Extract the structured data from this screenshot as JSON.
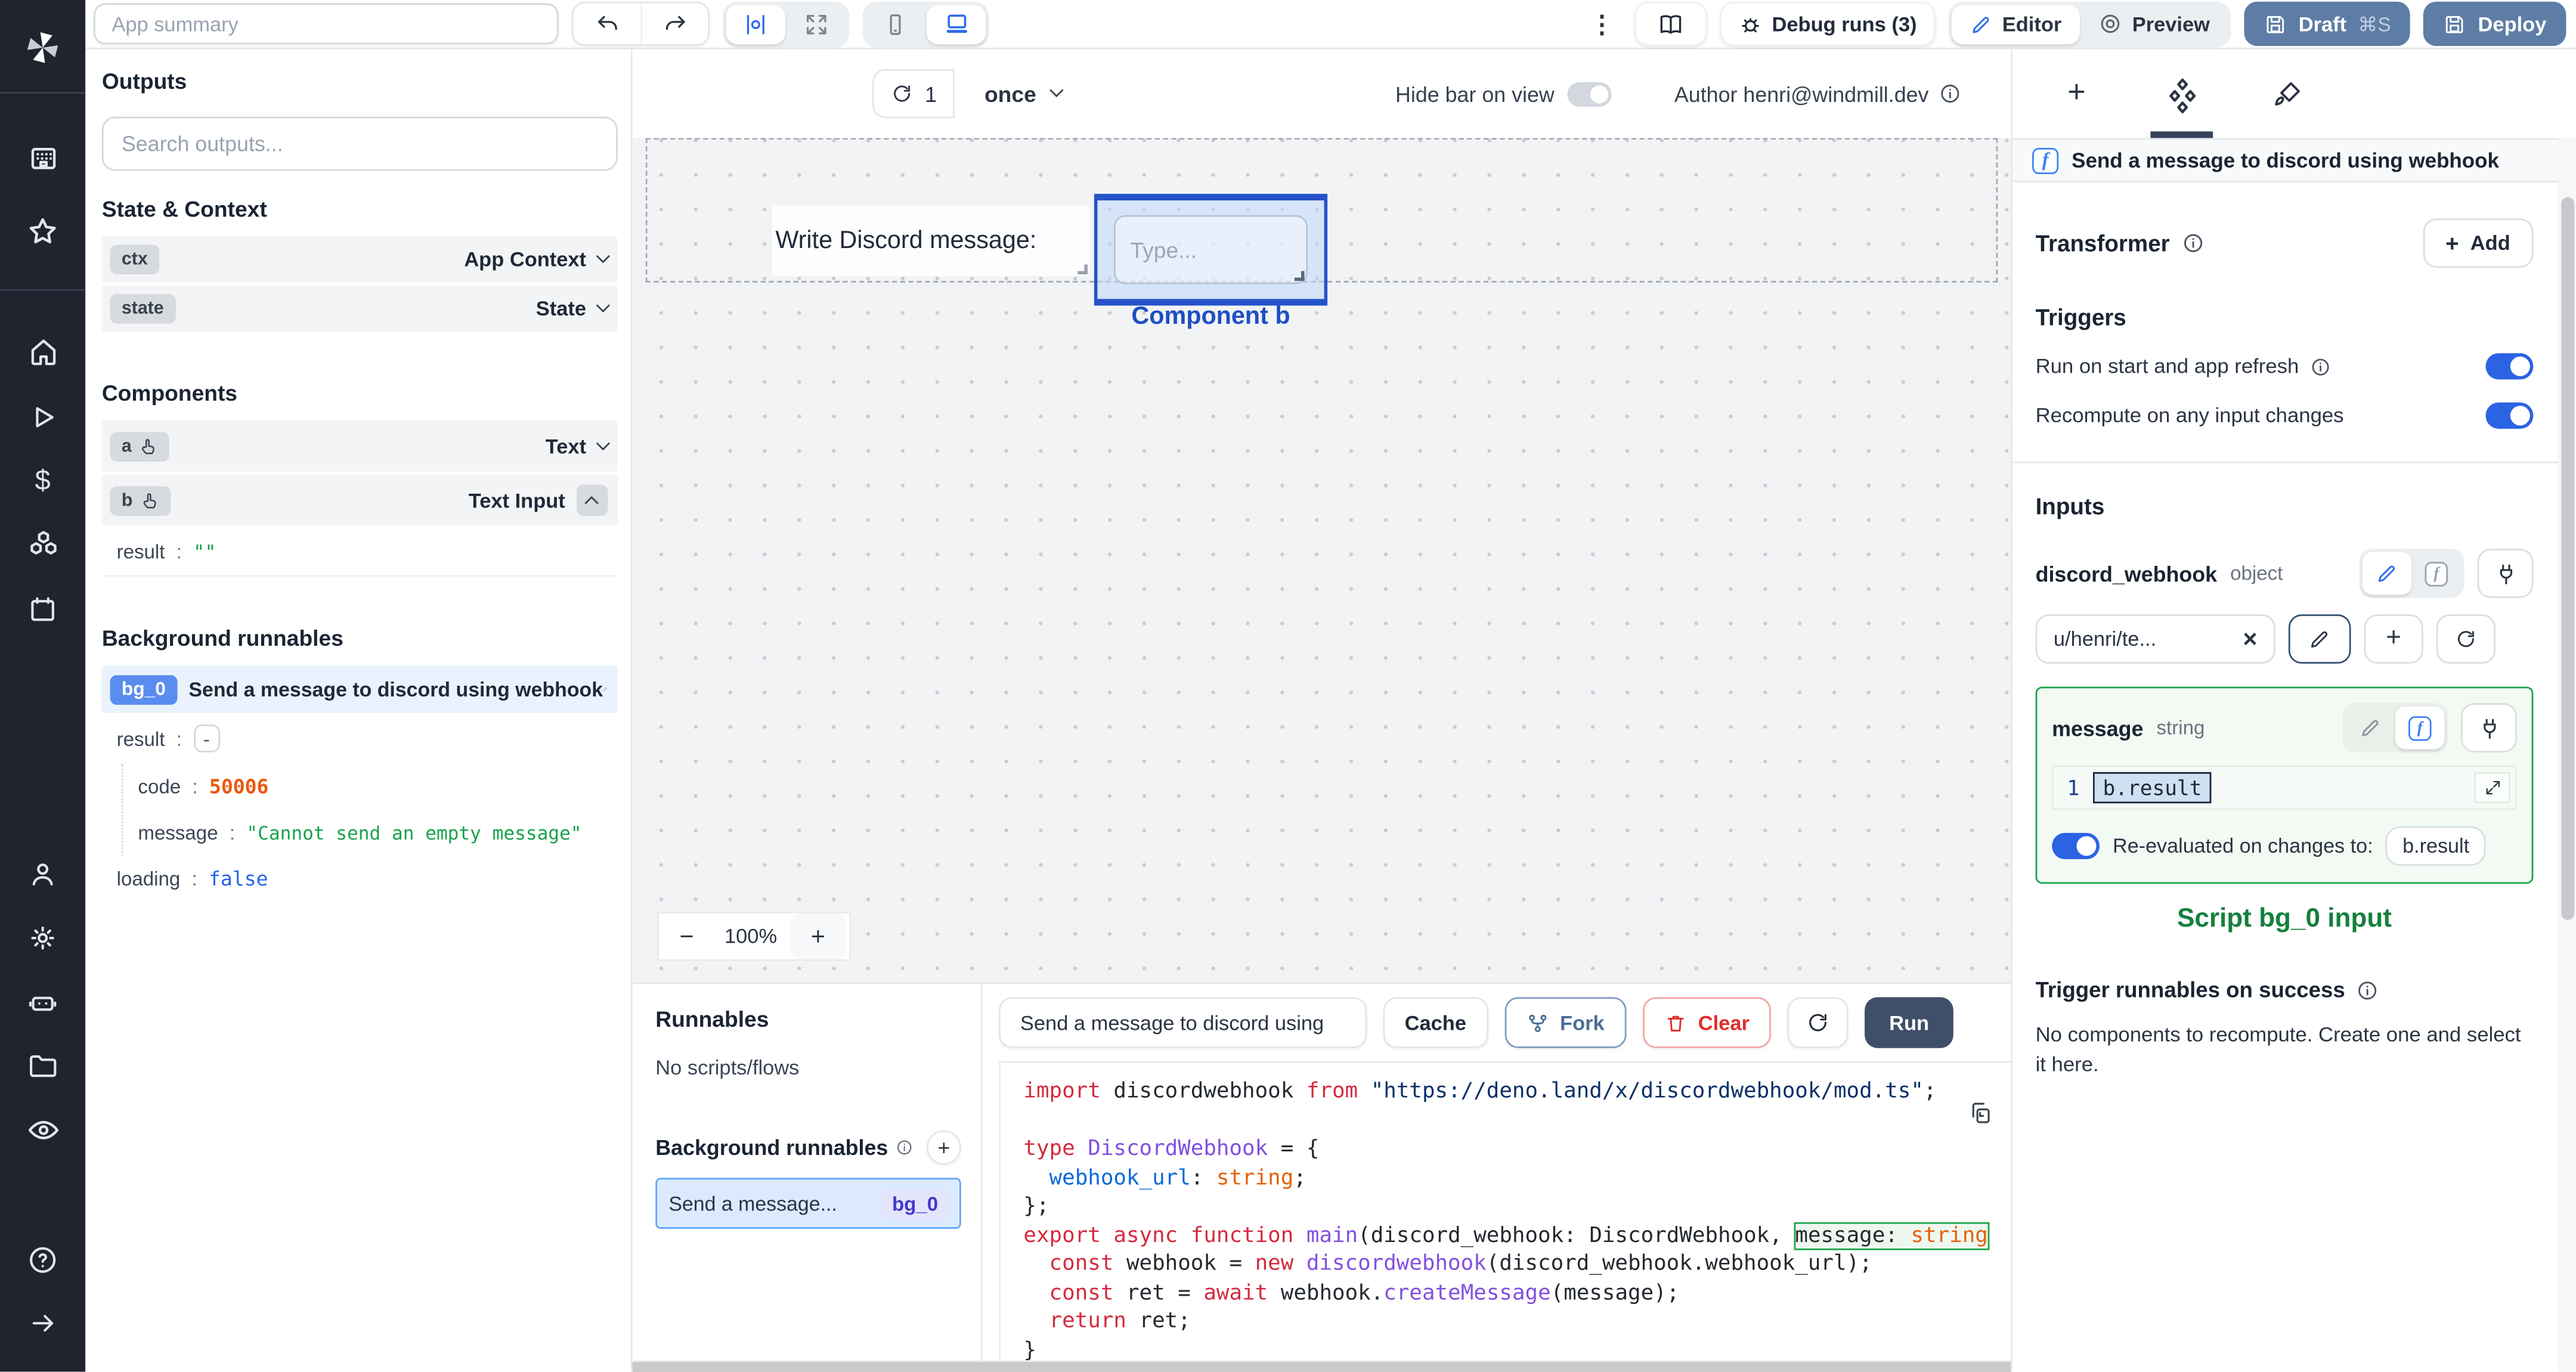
{
  "colors": {
    "accent": "#2563eb",
    "slate_button": "#5e7da6",
    "run_button": "#404f69",
    "success_green": "#16a34a",
    "error_orange": "#ea580c",
    "selection_blue": "#2553c9"
  },
  "topbar": {
    "app_summary_placeholder": "App summary",
    "debug_runs_label": "Debug runs (3)",
    "editor_label": "Editor",
    "preview_label": "Preview",
    "draft_label": "Draft",
    "draft_shortcut": "⌘S",
    "deploy_label": "Deploy"
  },
  "left_panel": {
    "outputs_title": "Outputs",
    "search_placeholder": "Search outputs...",
    "state_context_title": "State & Context",
    "context_rows": [
      {
        "key": "ctx",
        "type": "App Context"
      },
      {
        "key": "state",
        "type": "State"
      }
    ],
    "components_title": "Components",
    "component_rows": [
      {
        "key": "a",
        "type": "Text"
      },
      {
        "key": "b",
        "type": "Text Input"
      }
    ],
    "b_result": {
      "label": "result",
      "sep": ":",
      "value": "\"\""
    },
    "background_title": "Background runnables",
    "bg_runnable": {
      "badge": "bg_0",
      "name": "Send a message to discord using webhook"
    },
    "bg_result": {
      "label": "result",
      "sep": ":",
      "collapse": "-"
    },
    "bg_fields": [
      {
        "label": "code",
        "sep": ":",
        "value": "50006"
      },
      {
        "label": "message",
        "sep": ":",
        "value": "\"Cannot send an empty message\""
      },
      {
        "label": "loading",
        "sep": ":",
        "value": "false"
      }
    ]
  },
  "canvas": {
    "refresh_count": "1",
    "schedule": "once",
    "hide_bar_label": "Hide bar on view",
    "author_label": "Author henri@windmill.dev",
    "text_component": "Write Discord message:",
    "input_placeholder": "Type...",
    "selected_component_label": "Component b",
    "zoom_out": "−",
    "zoom_level": "100%",
    "zoom_in": "+"
  },
  "runnables": {
    "title": "Runnables",
    "empty": "No scripts/flows",
    "background_title": "Background runnables",
    "item": {
      "name": "Send a message...",
      "badge": "bg_0"
    }
  },
  "code_panel": {
    "tab": "Send a message to discord using",
    "cache_label": "Cache",
    "fork_label": "Fork",
    "clear_label": "Clear",
    "run_label": "Run",
    "lines": [
      [
        {
          "t": "import",
          "c": "k"
        },
        {
          "t": " discordwebhook ",
          "c": "d"
        },
        {
          "t": "from",
          "c": "k"
        },
        {
          "t": " ",
          "c": "d"
        },
        {
          "t": "\"https://deno.land/x/discordwebhook/mod.ts\"",
          "c": "s"
        },
        {
          "t": ";",
          "c": "d"
        }
      ],
      [],
      [
        {
          "t": "type",
          "c": "k"
        },
        {
          "t": " ",
          "c": "d"
        },
        {
          "t": "DiscordWebhook",
          "c": "p"
        },
        {
          "t": " = {",
          "c": "d"
        }
      ],
      [
        {
          "t": "  ",
          "c": "d"
        },
        {
          "t": "webhook_url",
          "c": "b"
        },
        {
          "t": ": ",
          "c": "d"
        },
        {
          "t": "string",
          "c": "o"
        },
        {
          "t": ";",
          "c": "d"
        }
      ],
      [
        {
          "t": "};",
          "c": "d"
        }
      ],
      [
        {
          "t": "export",
          "c": "k"
        },
        {
          "t": " ",
          "c": "d"
        },
        {
          "t": "async",
          "c": "k"
        },
        {
          "t": " ",
          "c": "d"
        },
        {
          "t": "function",
          "c": "k"
        },
        {
          "t": " ",
          "c": "d"
        },
        {
          "t": "main",
          "c": "p"
        },
        {
          "t": "(discord_webhook: DiscordWebhook, ",
          "c": "d"
        },
        {
          "t": "message: ",
          "c": "d",
          "hl": true
        },
        {
          "t": "string",
          "c": "o",
          "hl": true
        }
      ],
      [
        {
          "t": "  ",
          "c": "d"
        },
        {
          "t": "const",
          "c": "k"
        },
        {
          "t": " webhook = ",
          "c": "d"
        },
        {
          "t": "new",
          "c": "k"
        },
        {
          "t": " ",
          "c": "d"
        },
        {
          "t": "discordwebhook",
          "c": "p"
        },
        {
          "t": "(discord_webhook.webhook_url);",
          "c": "d"
        }
      ],
      [
        {
          "t": "  ",
          "c": "d"
        },
        {
          "t": "const",
          "c": "k"
        },
        {
          "t": " ret = ",
          "c": "d"
        },
        {
          "t": "await",
          "c": "k"
        },
        {
          "t": " webhook.",
          "c": "d"
        },
        {
          "t": "createMessage",
          "c": "p"
        },
        {
          "t": "(message);",
          "c": "d"
        }
      ],
      [
        {
          "t": "  ",
          "c": "d"
        },
        {
          "t": "return",
          "c": "k"
        },
        {
          "t": " ret;",
          "c": "d"
        }
      ],
      [
        {
          "t": "}",
          "c": "d"
        }
      ]
    ]
  },
  "right_panel": {
    "header": "Send a message to discord using webhook",
    "transformer_label": "Transformer",
    "add_label": "Add",
    "triggers_title": "Triggers",
    "trigger_rows": [
      "Run on start and app refresh",
      "Recompute on any input changes"
    ],
    "inputs_title": "Inputs",
    "discord_field": {
      "name": "discord_webhook",
      "type": "object",
      "value": "u/henri/te..."
    },
    "message_field": {
      "name": "message",
      "type": "string",
      "line_number": "1",
      "expression": "b.result"
    },
    "reeval_label": "Re-evaluated on changes to:",
    "reeval_target": "b.result",
    "script_input_label": "Script bg_0 input",
    "success_title": "Trigger runnables on success",
    "success_text": "No components to recompute. Create one and select it here."
  }
}
